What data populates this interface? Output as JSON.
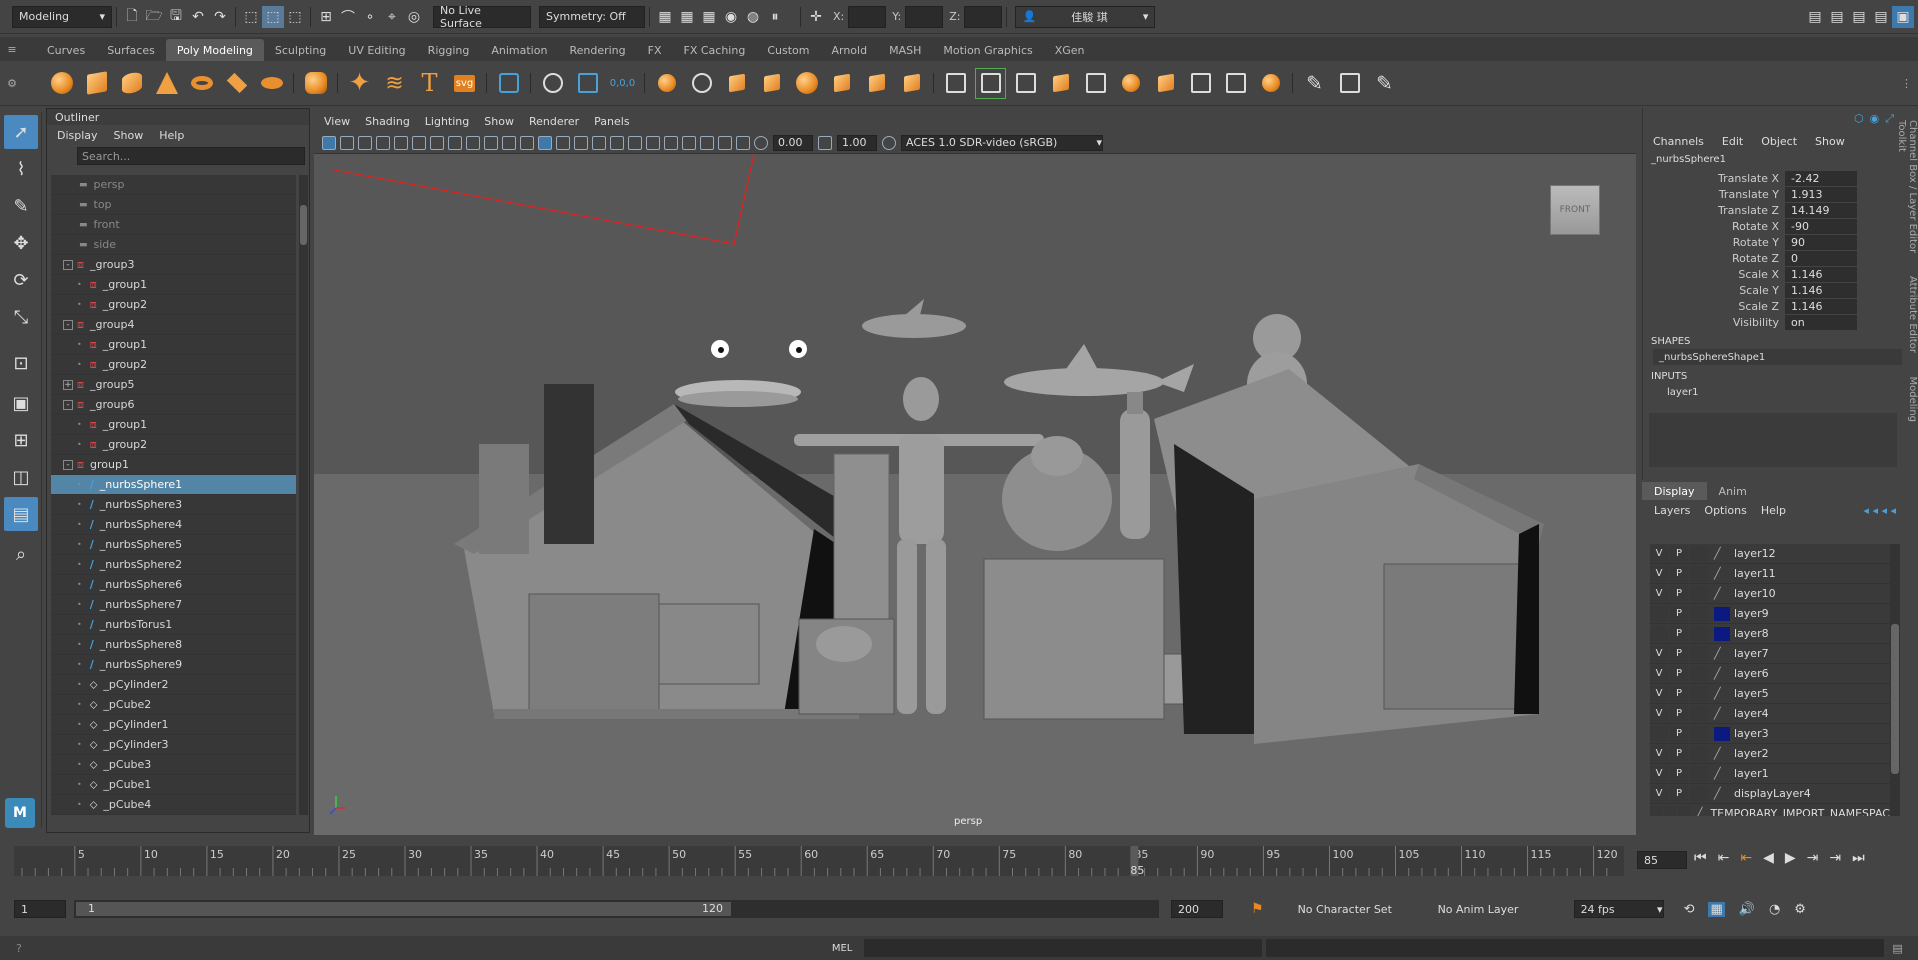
{
  "statusline": {
    "mode": "Modeling",
    "live_surface": "No Live Surface",
    "symmetry": "Symmetry: Off",
    "x_label": "X:",
    "y_label": "Y:",
    "z_label": "Z:",
    "user": "佳駿 琪"
  },
  "shelf_tabs": [
    "Curves",
    "Surfaces",
    "Poly Modeling",
    "Sculpting",
    "UV Editing",
    "Rigging",
    "Animation",
    "Rendering",
    "FX",
    "FX Caching",
    "Custom",
    "Arnold",
    "MASH",
    "Motion Graphics",
    "XGen"
  ],
  "shelf_active": "Poly Modeling",
  "shelf_icons": [
    "sphere-icon",
    "cube-icon",
    "cylinder-icon",
    "cone-icon",
    "torus-icon",
    "plane-icon",
    "disc-icon",
    "platonic-icon",
    "star-icon",
    "helix-icon",
    "text-icon",
    "svg-icon",
    "grid-icon",
    "measure-icon",
    "combine-icon",
    "separate-icon"
  ],
  "shelf_svg_label": "svg",
  "shelf_t_label": "T",
  "outliner": {
    "title": "Outliner",
    "menu": [
      "Display",
      "Show",
      "Help"
    ],
    "search_placeholder": "Search...",
    "items": [
      {
        "label": "persp",
        "indent": 0,
        "kind": "cam"
      },
      {
        "label": "top",
        "indent": 0,
        "kind": "cam"
      },
      {
        "label": "front",
        "indent": 0,
        "kind": "cam"
      },
      {
        "label": "side",
        "indent": 0,
        "kind": "cam"
      },
      {
        "label": "_group3",
        "indent": 1,
        "kind": "group",
        "exp": "-"
      },
      {
        "label": "_group1",
        "indent": 2,
        "kind": "group"
      },
      {
        "label": "_group2",
        "indent": 2,
        "kind": "group"
      },
      {
        "label": "_group4",
        "indent": 1,
        "kind": "group",
        "exp": "-"
      },
      {
        "label": "_group1",
        "indent": 2,
        "kind": "group"
      },
      {
        "label": "_group2",
        "indent": 2,
        "kind": "group"
      },
      {
        "label": "_group5",
        "indent": 1,
        "kind": "group",
        "exp": "+"
      },
      {
        "label": "_group6",
        "indent": 1,
        "kind": "group",
        "exp": "-"
      },
      {
        "label": "_group1",
        "indent": 2,
        "kind": "group"
      },
      {
        "label": "_group2",
        "indent": 2,
        "kind": "group"
      },
      {
        "label": "group1",
        "indent": 1,
        "kind": "group",
        "exp": "-"
      },
      {
        "label": "_nurbsSphere1",
        "indent": 2,
        "kind": "nurbs",
        "selected": true
      },
      {
        "label": "_nurbsSphere3",
        "indent": 2,
        "kind": "nurbs"
      },
      {
        "label": "_nurbsSphere4",
        "indent": 2,
        "kind": "nurbs"
      },
      {
        "label": "_nurbsSphere5",
        "indent": 2,
        "kind": "nurbs"
      },
      {
        "label": "_nurbsSphere2",
        "indent": 2,
        "kind": "nurbs"
      },
      {
        "label": "_nurbsSphere6",
        "indent": 2,
        "kind": "nurbs"
      },
      {
        "label": "_nurbsSphere7",
        "indent": 2,
        "kind": "nurbs"
      },
      {
        "label": "_nurbsTorus1",
        "indent": 2,
        "kind": "nurbs"
      },
      {
        "label": "_nurbsSphere8",
        "indent": 2,
        "kind": "nurbs"
      },
      {
        "label": "_nurbsSphere9",
        "indent": 2,
        "kind": "nurbs"
      },
      {
        "label": "_pCylinder2",
        "indent": 2,
        "kind": "poly"
      },
      {
        "label": "_pCube2",
        "indent": 2,
        "kind": "poly"
      },
      {
        "label": "_pCylinder1",
        "indent": 2,
        "kind": "poly"
      },
      {
        "label": "_pCylinder3",
        "indent": 2,
        "kind": "poly"
      },
      {
        "label": "_pCube3",
        "indent": 2,
        "kind": "poly"
      },
      {
        "label": "_pCube1",
        "indent": 2,
        "kind": "poly"
      },
      {
        "label": "_pCube4",
        "indent": 2,
        "kind": "poly"
      }
    ]
  },
  "viewport": {
    "menu": [
      "View",
      "Shading",
      "Lighting",
      "Show",
      "Renderer",
      "Panels"
    ],
    "near": "0.00",
    "far": "1.00",
    "colorspace": "ACES 1.0 SDR-video (sRGB)",
    "camera_label": "persp",
    "viewcube": "FRONT"
  },
  "channelbox": {
    "menu": [
      "Channels",
      "Edit",
      "Object",
      "Show"
    ],
    "node": "_nurbsSphere1",
    "attrs": [
      {
        "name": "Translate X",
        "value": "-2.42"
      },
      {
        "name": "Translate Y",
        "value": "1.913"
      },
      {
        "name": "Translate Z",
        "value": "14.149"
      },
      {
        "name": "Rotate X",
        "value": "-90"
      },
      {
        "name": "Rotate Y",
        "value": "90"
      },
      {
        "name": "Rotate Z",
        "value": "0"
      },
      {
        "name": "Scale X",
        "value": "1.146"
      },
      {
        "name": "Scale Y",
        "value": "1.146"
      },
      {
        "name": "Scale Z",
        "value": "1.146"
      },
      {
        "name": "Visibility",
        "value": "on"
      }
    ],
    "shapes_label": "SHAPES",
    "shape": "_nurbsSphereShape1",
    "inputs_label": "INPUTS",
    "input": "layer1",
    "side_tabs": [
      "Channel Box / Layer Editor",
      "Attribute Editor",
      "Modeling Toolkit"
    ]
  },
  "layers": {
    "tabs": [
      "Display",
      "Anim"
    ],
    "menu": [
      "Layers",
      "Options",
      "Help"
    ],
    "rows": [
      {
        "v": "V",
        "p": "P",
        "name": "layer12",
        "color": ""
      },
      {
        "v": "V",
        "p": "P",
        "name": "layer11",
        "color": ""
      },
      {
        "v": "V",
        "p": "P",
        "name": "layer10",
        "color": ""
      },
      {
        "v": "",
        "p": "P",
        "name": "layer9",
        "color": "#0a1a80"
      },
      {
        "v": "",
        "p": "P",
        "name": "layer8",
        "color": "#0a1a80"
      },
      {
        "v": "V",
        "p": "P",
        "name": "layer7",
        "color": ""
      },
      {
        "v": "V",
        "p": "P",
        "name": "layer6",
        "color": ""
      },
      {
        "v": "V",
        "p": "P",
        "name": "layer5",
        "color": ""
      },
      {
        "v": "V",
        "p": "P",
        "name": "layer4",
        "color": ""
      },
      {
        "v": "",
        "p": "P",
        "name": "layer3",
        "color": "#0a1a80"
      },
      {
        "v": "V",
        "p": "P",
        "name": "layer2",
        "color": ""
      },
      {
        "v": "V",
        "p": "P",
        "name": "layer1",
        "color": ""
      },
      {
        "v": "V",
        "p": "P",
        "name": "displayLayer4",
        "color": ""
      },
      {
        "v": "",
        "p": "",
        "name": "TEMPORARY_IMPORT_NAMESPAC",
        "color": ""
      }
    ]
  },
  "timeline": {
    "ticks": [
      "5",
      "10",
      "15",
      "20",
      "25",
      "30",
      "35",
      "40",
      "45",
      "50",
      "55",
      "60",
      "65",
      "70",
      "75",
      "80",
      "85",
      "90",
      "95",
      "100",
      "105",
      "110",
      "115",
      "120"
    ],
    "current": "85",
    "current_frame_field": "85"
  },
  "range": {
    "start": "1",
    "inner_start": "1",
    "inner_end": "120",
    "end": "200",
    "character_set": "No Character Set",
    "anim_layer": "No Anim Layer",
    "fps": "24 fps"
  },
  "cmd": {
    "label": "MEL"
  }
}
